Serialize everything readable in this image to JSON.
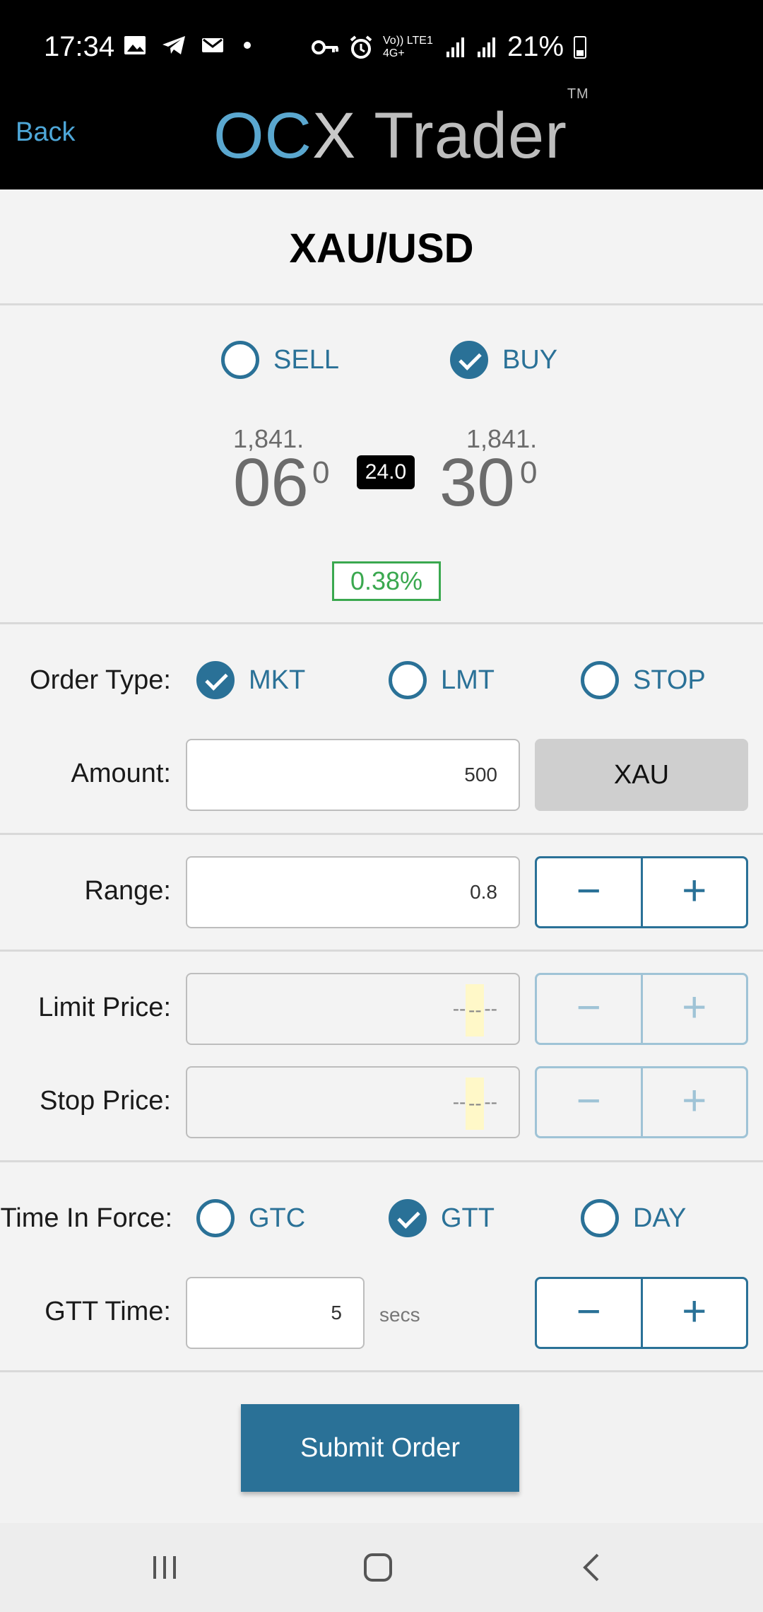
{
  "status_bar": {
    "time": "17:34",
    "network_label": "Vo)) LTE1 4G+",
    "battery": "21%",
    "icons": [
      "gallery-icon",
      "telegram-icon",
      "notification-icon",
      "dot-icon",
      "vpn-key-icon",
      "alarm-icon",
      "volte-icon",
      "4g-icon",
      "signal-icon",
      "roaming-signal-icon",
      "battery-icon"
    ]
  },
  "header": {
    "back_label": "Back",
    "logo": {
      "oc": "OC",
      "x": "X",
      "trader": " Trader",
      "tm": "TM"
    },
    "colors": {
      "logo_blue": "#5aa7cf",
      "logo_gray": "#bdbdbd",
      "back": "#4ea7d8"
    }
  },
  "instrument": {
    "pair": "XAU/USD"
  },
  "side": {
    "sell_label": "SELL",
    "buy_label": "BUY",
    "selected": "BUY"
  },
  "quote": {
    "sell_big_figure": "1,841.",
    "sell_pips": "06",
    "sell_fraction": "0",
    "spread": "24.0",
    "buy_big_figure": "1,841.",
    "buy_pips": "30",
    "buy_fraction": "0",
    "change": "0.38%",
    "change_color": "#3aa84f"
  },
  "order_type": {
    "label": "Order Type:",
    "options": [
      "MKT",
      "LMT",
      "STOP"
    ],
    "selected": "MKT"
  },
  "amount": {
    "label": "Amount:",
    "value": "500",
    "unit": "XAU"
  },
  "range": {
    "label": "Range:",
    "value": "0.8",
    "minus": "−",
    "plus": "+"
  },
  "limit_price": {
    "label": "Limit Price:",
    "placeholder_left": "--",
    "placeholder_mid": "--",
    "placeholder_right": "--",
    "minus": "−",
    "plus": "+"
  },
  "stop_price": {
    "label": "Stop Price:",
    "placeholder_left": "--",
    "placeholder_mid": "--",
    "placeholder_right": "--",
    "minus": "−",
    "plus": "+"
  },
  "time_in_force": {
    "label": "Time In Force:",
    "options": [
      "GTC",
      "GTT",
      "DAY"
    ],
    "selected": "GTT"
  },
  "gtt_time": {
    "label": "GTT Time:",
    "value": "5",
    "unit": "secs",
    "minus": "−",
    "plus": "+"
  },
  "submit_label": "Submit Order",
  "accent_color": "#2a7197",
  "nav": {
    "icons": [
      "recents-icon",
      "home-icon",
      "back-icon"
    ]
  }
}
